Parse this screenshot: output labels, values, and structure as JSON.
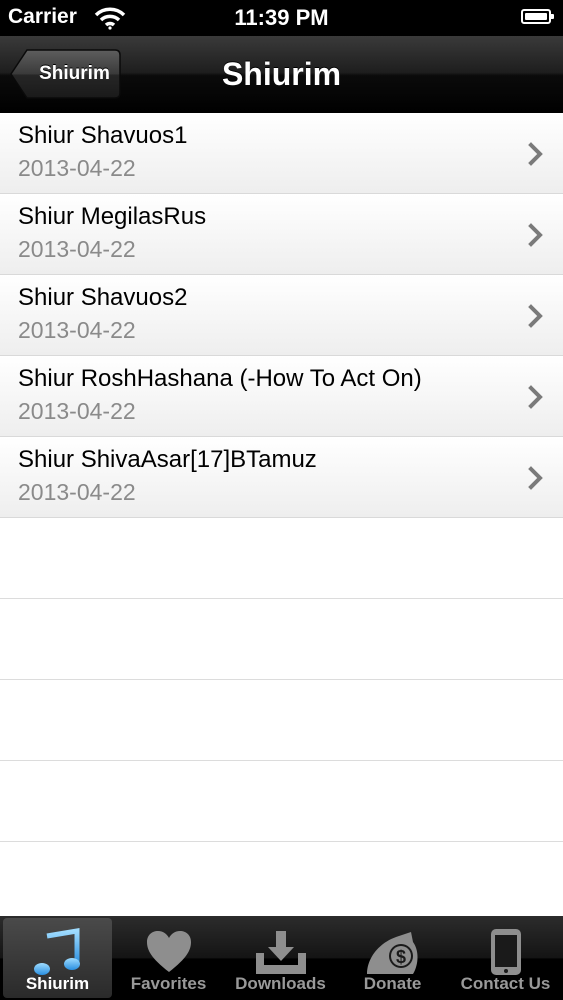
{
  "status_bar": {
    "carrier": "Carrier",
    "time": "11:39 PM"
  },
  "nav": {
    "back_label": "Shiurim",
    "title": "Shiurim"
  },
  "list": {
    "items": [
      {
        "title": "Shiur Shavuos1",
        "date": "2013-04-22"
      },
      {
        "title": "Shiur MegilasRus",
        "date": "2013-04-22"
      },
      {
        "title": "Shiur Shavuos2",
        "date": "2013-04-22"
      },
      {
        "title": "Shiur RoshHashana (-How To Act On)",
        "date": "2013-04-22"
      },
      {
        "title": "Shiur ShivaAsar[17]BTamuz",
        "date": "2013-04-22"
      }
    ]
  },
  "tab_bar": {
    "tabs": [
      {
        "label": "Shiurim",
        "icon": "music-note-icon",
        "selected": true
      },
      {
        "label": "Favorites",
        "icon": "heart-icon",
        "selected": false
      },
      {
        "label": "Downloads",
        "icon": "download-tray-icon",
        "selected": false
      },
      {
        "label": "Donate",
        "icon": "money-bag-icon",
        "selected": false
      },
      {
        "label": "Contact Us",
        "icon": "phone-device-icon",
        "selected": false
      }
    ]
  },
  "colors": {
    "accent_blue": "#5ab4f0",
    "subtitle_gray": "#8a8a8a"
  }
}
